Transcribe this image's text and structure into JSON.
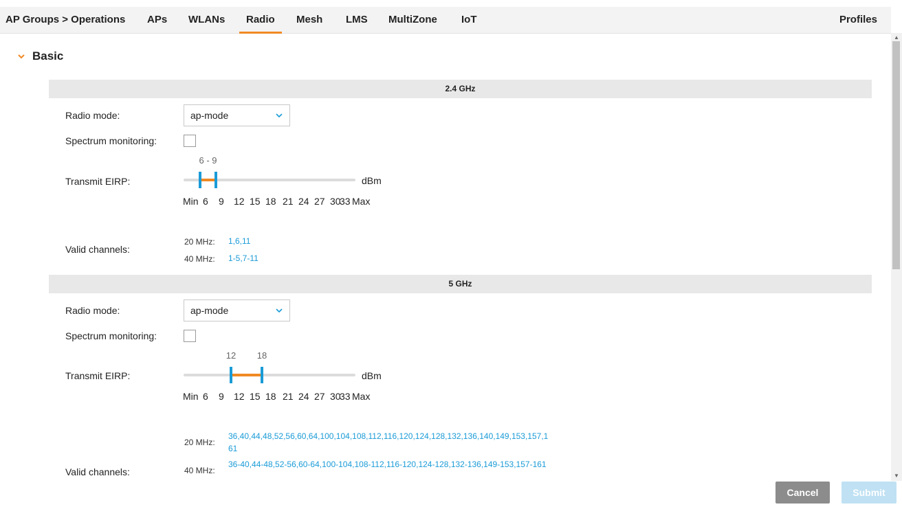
{
  "nav": {
    "breadcrumb": "AP Groups > Operations",
    "tabs": [
      {
        "label": "APs"
      },
      {
        "label": "WLANs"
      },
      {
        "label": "Radio"
      },
      {
        "label": "Mesh"
      },
      {
        "label": "LMS"
      },
      {
        "label": "MultiZone"
      },
      {
        "label": "IoT"
      }
    ],
    "active_tab": "Radio",
    "profiles": "Profiles"
  },
  "section": {
    "title": "Basic"
  },
  "bands": [
    {
      "title": "2.4 GHz",
      "radio_mode_label": "Radio mode:",
      "radio_mode_value": "ap-mode",
      "spectrum_label": "Spectrum monitoring:",
      "spectrum_checked": false,
      "eirp_label": "Transmit EIRP:",
      "eirp_display": "6 - 9",
      "eirp_min": 6,
      "eirp_max": 9,
      "unit": "dBm",
      "ticks": [
        "Min",
        "6",
        "9",
        "12",
        "15",
        "18",
        "21",
        "24",
        "27",
        "30",
        "33",
        "Max"
      ],
      "valid_label": "Valid channels:",
      "channels": [
        {
          "key": "20 MHz:",
          "value": "1,6,11"
        },
        {
          "key": "40 MHz:",
          "value": "1-5,7-11"
        }
      ]
    },
    {
      "title": "5 GHz",
      "radio_mode_label": "Radio mode:",
      "radio_mode_value": "ap-mode",
      "spectrum_label": "Spectrum monitoring:",
      "spectrum_checked": false,
      "eirp_label": "Transmit EIRP:",
      "eirp_low_text": "12",
      "eirp_high_text": "18",
      "eirp_min": 12,
      "eirp_max": 18,
      "unit": "dBm",
      "ticks": [
        "Min",
        "6",
        "9",
        "12",
        "15",
        "18",
        "21",
        "24",
        "27",
        "30",
        "33",
        "Max"
      ],
      "valid_label": "Valid channels:",
      "channels": [
        {
          "key": "20 MHz:",
          "value": "36,40,44,48,52,56,60,64,100,104,108,112,116,120,124,128,132,136,140,149,153,157,161"
        },
        {
          "key": "40 MHz:",
          "value": "36-40,44-48,52-56,60-64,100-104,108-112,116-120,124-128,132-136,149-153,157-161"
        }
      ]
    }
  ],
  "buttons": {
    "cancel": "Cancel",
    "submit": "Submit"
  },
  "colors": {
    "accent": "#f08a24",
    "link": "#1a9bd7",
    "cancel_bg": "#8c8c8c",
    "submit_bg": "#bfe1f3"
  }
}
